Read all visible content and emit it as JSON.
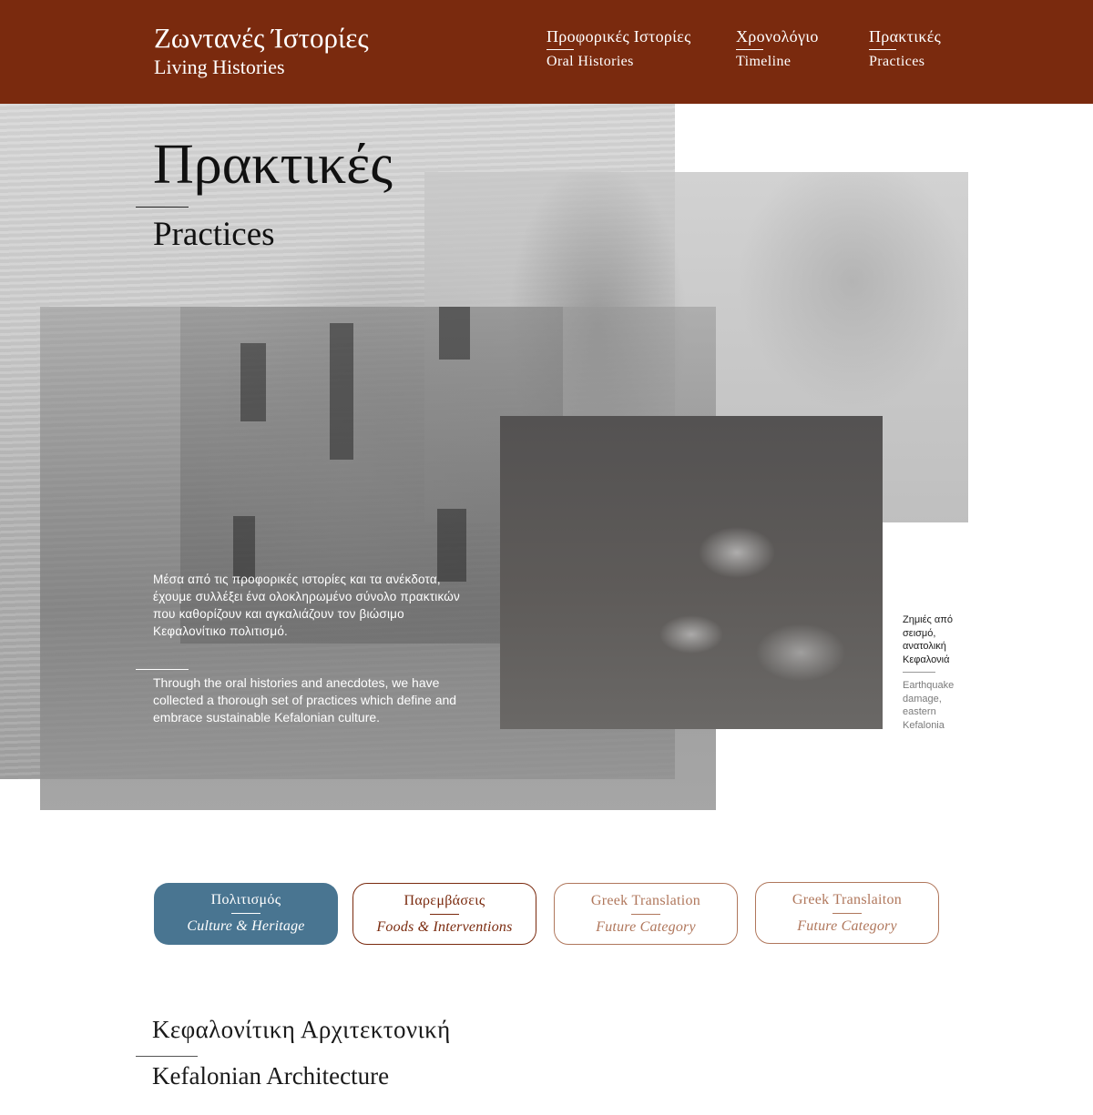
{
  "header": {
    "brand_gr": "Ζωντανές Ίστορίες",
    "brand_en": "Living Histories",
    "nav": [
      {
        "gr": "Προφορικές Ιστορίες",
        "en": "Oral Histories"
      },
      {
        "gr": "Χρονολόγιο",
        "en": "Timeline"
      },
      {
        "gr": "Πρακτικές",
        "en": "Practices"
      }
    ]
  },
  "hero": {
    "title_gr": "Πρακτικές",
    "title_en": "Practices",
    "intro_gr": "Μέσα από τις προφορικές ιστορίες και τα ανέκδοτα, έχουμε συλλέξει ένα ολοκληρωμένο σύνολο πρακτικών που καθορίζουν και αγκαλιάζουν τον βιώσιμο Κεφαλονίτικο πολιτισμό.",
    "intro_en": "Through the oral histories and anecdotes, we have collected a thorough set of practices which define and embrace sustainable Kefalonian culture.",
    "caption_gr": "Ζημιές από σεισμό, ανατολική Κεφαλονιά",
    "caption_en": "Earthquake damage, eastern Kefalonia"
  },
  "categories": [
    {
      "gr": "Πολιτισμός",
      "en": "Culture & Heritage"
    },
    {
      "gr": "Παρεμβάσεις",
      "en": "Foods & Interventions"
    },
    {
      "gr": "Greek Translation",
      "en": "Future Category"
    },
    {
      "gr": "Greek Translaiton",
      "en": "Future Category"
    }
  ],
  "section": {
    "title_gr": "Κεφαλονίτικη Αρχιτεκτονική",
    "title_en": "Kefalonian Architecture"
  },
  "colors": {
    "header_bg": "#7a2a0e",
    "active_category": "#497591",
    "category_outline": "#7a2a0e",
    "future_outline": "#b0775c"
  }
}
